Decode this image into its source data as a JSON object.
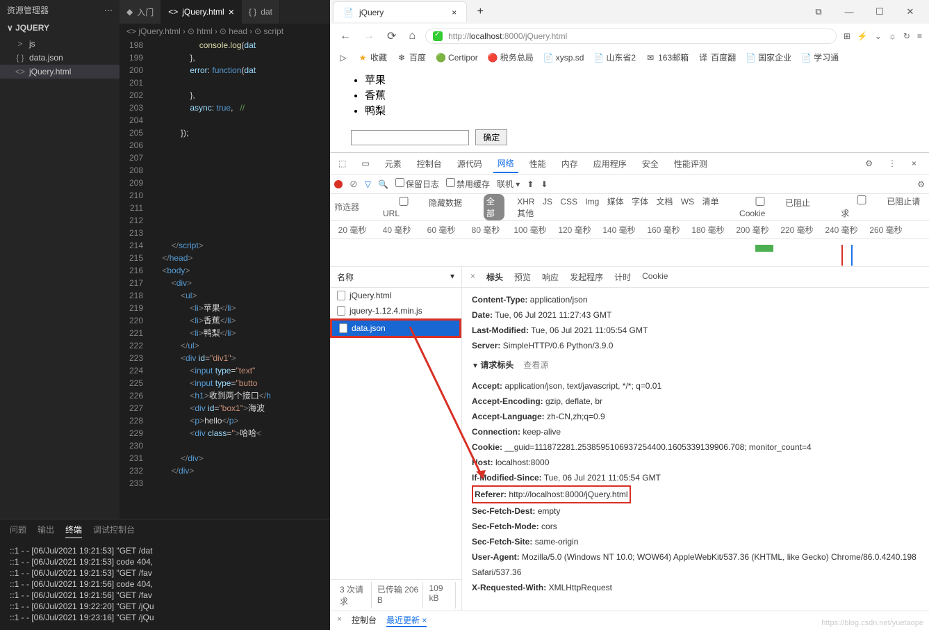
{
  "vscode": {
    "explorer_title": "资源管理器",
    "project": "JQUERY",
    "tree": [
      {
        "icon": ">",
        "name": "js",
        "cls": ""
      },
      {
        "icon": "{ }",
        "name": "data.json",
        "cls": "ic-json"
      },
      {
        "icon": "<>",
        "name": "jQuery.html",
        "cls": "ic-html",
        "sel": true
      }
    ],
    "tabs": [
      {
        "icon": "◆",
        "label": "入门"
      },
      {
        "icon": "<>",
        "label": "jQuery.html",
        "active": true,
        "close": "×"
      },
      {
        "icon": "{ }",
        "label": "dat"
      }
    ],
    "crumbs": [
      "<> jQuery.html",
      "⊙ html",
      "⊙ head",
      "⊙ script"
    ],
    "code": [
      {
        "n": 198,
        "h": "                    <span class='f'>console</span>.<span class='f'>log</span>(<span class='a'>dat</span>"
      },
      {
        "n": 199,
        "h": "                },"
      },
      {
        "n": 200,
        "h": "                <span class='a'>error</span>: <span class='p'>function</span>(<span class='a'>dat</span>"
      },
      {
        "n": 201,
        "h": ""
      },
      {
        "n": 202,
        "h": "                },"
      },
      {
        "n": 203,
        "h": "                <span class='a'>async</span>: <span class='p'>true</span>,   <span class='c'>//</span>"
      },
      {
        "n": 204,
        "h": ""
      },
      {
        "n": 205,
        "h": "            });"
      },
      {
        "n": 206,
        "h": ""
      },
      {
        "n": 207,
        "h": ""
      },
      {
        "n": 208,
        "h": ""
      },
      {
        "n": 209,
        "h": ""
      },
      {
        "n": 210,
        "h": ""
      },
      {
        "n": 211,
        "h": ""
      },
      {
        "n": 212,
        "h": ""
      },
      {
        "n": 213,
        "h": ""
      },
      {
        "n": 214,
        "h": "        <span class='t'>&lt;/</span><span class='k'>script</span><span class='t'>&gt;</span>"
      },
      {
        "n": 215,
        "h": "    <span class='t'>&lt;/</span><span class='k'>head</span><span class='t'>&gt;</span>"
      },
      {
        "n": 216,
        "h": "    <span class='t'>&lt;</span><span class='k'>body</span><span class='t'>&gt;</span>"
      },
      {
        "n": 217,
        "h": "        <span class='t'>&lt;</span><span class='k'>div</span><span class='t'>&gt;</span>"
      },
      {
        "n": 218,
        "h": "            <span class='t'>&lt;</span><span class='k'>ul</span><span class='t'>&gt;</span>"
      },
      {
        "n": 219,
        "h": "                <span class='t'>&lt;</span><span class='k'>li</span><span class='t'>&gt;</span>苹果<span class='t'>&lt;/</span><span class='k'>li</span><span class='t'>&gt;</span>"
      },
      {
        "n": 220,
        "h": "                <span class='t'>&lt;</span><span class='k'>li</span><span class='t'>&gt;</span>香蕉<span class='t'>&lt;/</span><span class='k'>li</span><span class='t'>&gt;</span>"
      },
      {
        "n": 221,
        "h": "                <span class='t'>&lt;</span><span class='k'>li</span><span class='t'>&gt;</span>鸭梨<span class='t'>&lt;/</span><span class='k'>li</span><span class='t'>&gt;</span>"
      },
      {
        "n": 222,
        "h": "            <span class='t'>&lt;/</span><span class='k'>ul</span><span class='t'>&gt;</span>"
      },
      {
        "n": 223,
        "h": "            <span class='t'>&lt;</span><span class='k'>div</span> <span class='a'>id</span>=<span class='s'>\"div1\"</span><span class='t'>&gt;</span>"
      },
      {
        "n": 224,
        "h": "                <span class='t'>&lt;</span><span class='k'>input</span> <span class='a'>type</span>=<span class='s'>\"text\"</span>"
      },
      {
        "n": 225,
        "h": "                <span class='t'>&lt;</span><span class='k'>input</span> <span class='a'>type</span>=<span class='s'>\"butto</span>"
      },
      {
        "n": 226,
        "h": "                <span class='t'>&lt;</span><span class='k'>h1</span><span class='t'>&gt;</span>收到两个接口<span class='t'>&lt;/</span><span class='k'>h</span>"
      },
      {
        "n": 227,
        "h": "                <span class='t'>&lt;</span><span class='k'>div</span> <span class='a'>id</span>=<span class='s'>\"box1\"</span><span class='t'>&gt;</span>海波"
      },
      {
        "n": 228,
        "h": "                <span class='t'>&lt;</span><span class='k'>p</span><span class='t'>&gt;</span>hello<span class='t'>&lt;/</span><span class='k'>p</span><span class='t'>&gt;</span>"
      },
      {
        "n": 229,
        "h": "                <span class='t'>&lt;</span><span class='k'>div</span> <span class='a'>class</span>=<span class='s'>''</span><span class='t'>&gt;</span>哈哈<span class='t'>&lt;</span>"
      },
      {
        "n": 230,
        "h": ""
      },
      {
        "n": 231,
        "h": "            <span class='t'>&lt;/</span><span class='k'>div</span><span class='t'>&gt;</span>"
      },
      {
        "n": 232,
        "h": "        <span class='t'>&lt;/</span><span class='k'>div</span><span class='t'>&gt;</span>"
      },
      {
        "n": 233,
        "h": ""
      }
    ],
    "term_tabs": [
      "问题",
      "输出",
      "终端",
      "调试控制台"
    ],
    "term_active": 2,
    "term_lines": [
      "::1 - - [06/Jul/2021 19:21:53] \"GET /dat",
      "::1 - - [06/Jul/2021 19:21:53] code 404,",
      "::1 - - [06/Jul/2021 19:21:53] \"GET /fav",
      "::1 - - [06/Jul/2021 19:21:56] code 404,",
      "::1 - - [06/Jul/2021 19:21:56] \"GET /fav",
      "::1 - - [06/Jul/2021 19:22:20] \"GET /jQu",
      "::1 - - [06/Jul/2021 19:23:16] \"GET /jQu"
    ]
  },
  "browser": {
    "tab_title": "jQuery",
    "url_prefix": "http://",
    "url_host": "localhost",
    "url_rest": ":8000/jQuery.html",
    "bookmarks": [
      {
        "i": "▷",
        "l": ""
      },
      {
        "i": "★",
        "l": "收藏",
        "cls": "star"
      },
      {
        "i": "❄",
        "l": "百度"
      },
      {
        "i": "🟢",
        "l": "Certipor"
      },
      {
        "i": "🔴",
        "l": "税务总局"
      },
      {
        "i": "📄",
        "l": "xysp.sd"
      },
      {
        "i": "📄",
        "l": "山东省2"
      },
      {
        "i": "✉",
        "l": "163邮箱"
      },
      {
        "i": "译",
        "l": "百度翻"
      },
      {
        "i": "📄",
        "l": "国家企业"
      },
      {
        "i": "📄",
        "l": "学习通"
      }
    ],
    "page_items": [
      "苹果",
      "香蕉",
      "鸭梨"
    ],
    "submit": "确定"
  },
  "devtools": {
    "main_tabs": [
      "元素",
      "控制台",
      "源代码",
      "网络",
      "性能",
      "内存",
      "应用程序",
      "安全",
      "性能评测"
    ],
    "main_active": 3,
    "bar2": {
      "keep": "保留日志",
      "cache": "禁用缓存",
      "net": "联机"
    },
    "filter_ph": "筛选器",
    "hide": "隐藏数据 URL",
    "all": "全部",
    "types": [
      "XHR",
      "JS",
      "CSS",
      "Img",
      "媒体",
      "字体",
      "文档",
      "WS",
      "清单",
      "其他"
    ],
    "block_cookie": "已阻止 Cookie",
    "block_req": "已阻止请求",
    "ticks": [
      "20 毫秒",
      "40 毫秒",
      "60 毫秒",
      "80 毫秒",
      "100 毫秒",
      "120 毫秒",
      "140 毫秒",
      "160 毫秒",
      "180 毫秒",
      "200 毫秒",
      "220 毫秒",
      "240 毫秒",
      "260 毫秒"
    ],
    "list_head": "名称",
    "requests": [
      {
        "name": "jQuery.html"
      },
      {
        "name": "jquery-1.12.4.min.js"
      },
      {
        "name": "data.json",
        "sel": true
      }
    ],
    "detail_tabs": [
      "标头",
      "预览",
      "响应",
      "发起程序",
      "计时",
      "Cookie"
    ],
    "detail_active": 0,
    "headers_top": [
      {
        "k": "Content-Type:",
        "v": " application/json"
      },
      {
        "k": "Date:",
        "v": " Tue, 06 Jul 2021 11:27:43 GMT"
      },
      {
        "k": "Last-Modified:",
        "v": " Tue, 06 Jul 2021 11:05:54 GMT"
      },
      {
        "k": "Server:",
        "v": " SimpleHTTP/0.6 Python/3.9.0"
      }
    ],
    "req_section": "请求标头",
    "see_src": "查看源",
    "headers_req": [
      {
        "k": "Accept:",
        "v": " application/json, text/javascript, */*; q=0.01"
      },
      {
        "k": "Accept-Encoding:",
        "v": " gzip, deflate, br"
      },
      {
        "k": "Accept-Language:",
        "v": " zh-CN,zh;q=0.9"
      },
      {
        "k": "Connection:",
        "v": " keep-alive"
      },
      {
        "k": "Cookie:",
        "v": " __guid=111872281.2538595106937254400.1605339139906.708; monitor_count=4"
      },
      {
        "k": "Host:",
        "v": " localhost:8000"
      },
      {
        "k": "If-Modified-Since:",
        "v": " Tue, 06 Jul 2021 11:05:54 GMT"
      },
      {
        "k": "Referer:",
        "v": " http://localhost:8000/jQuery.html",
        "box": true
      },
      {
        "k": "Sec-Fetch-Dest:",
        "v": " empty"
      },
      {
        "k": "Sec-Fetch-Mode:",
        "v": " cors"
      },
      {
        "k": "Sec-Fetch-Site:",
        "v": " same-origin"
      },
      {
        "k": "User-Agent:",
        "v": " Mozilla/5.0 (Windows NT 10.0; WOW64) AppleWebKit/537.36 (KHTML, like Gecko) Chrome/86.0.4240.198 Safari/537.36"
      },
      {
        "k": "X-Requested-With:",
        "v": " XMLHttpRequest"
      }
    ],
    "foot": [
      "3 次请求",
      "已传输 206 B",
      "109 kB"
    ],
    "status": [
      "控制台",
      "最近更新"
    ],
    "watermark": "https://blog.csdn.net/yuetaope"
  }
}
